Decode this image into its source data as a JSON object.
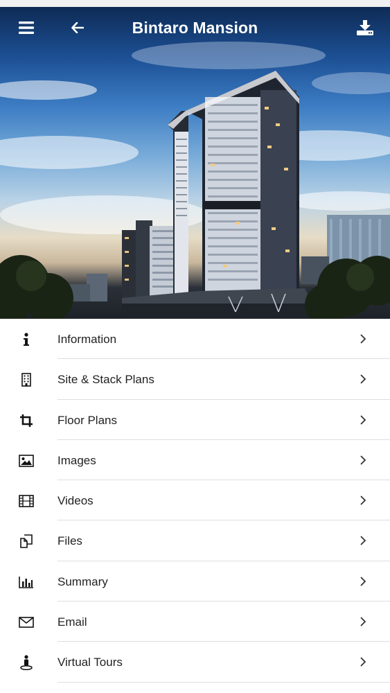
{
  "header": {
    "title": "Bintaro Mansion",
    "icons": {
      "menu": "hamburger-icon",
      "back": "arrow-left-icon",
      "download": "download-icon"
    }
  },
  "hero": {
    "subject": "building-photo"
  },
  "menu": {
    "items": [
      {
        "label": "Information",
        "icon": "info-icon"
      },
      {
        "label": "Site & Stack Plans",
        "icon": "building-icon"
      },
      {
        "label": "Floor Plans",
        "icon": "crop-icon"
      },
      {
        "label": "Images",
        "icon": "image-icon"
      },
      {
        "label": "Videos",
        "icon": "film-icon"
      },
      {
        "label": "Files",
        "icon": "files-icon"
      },
      {
        "label": "Summary",
        "icon": "bar-chart-icon"
      },
      {
        "label": "Email",
        "icon": "envelope-icon"
      },
      {
        "label": "Virtual Tours",
        "icon": "street-view-icon"
      }
    ]
  },
  "colors": {
    "header_text": "#ffffff",
    "list_text": "#222222",
    "divider": "#dedede"
  }
}
